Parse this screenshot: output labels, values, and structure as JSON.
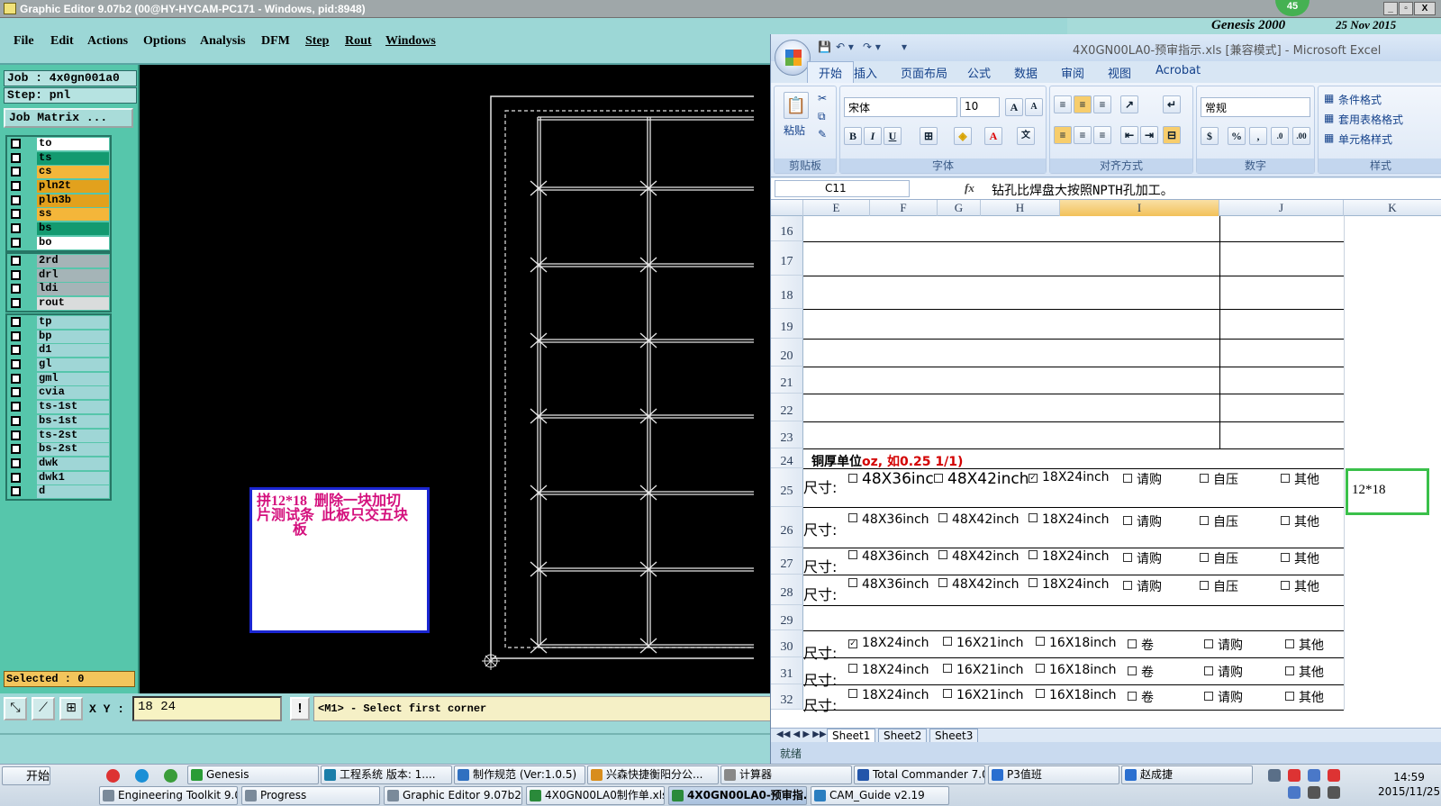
{
  "genesis": {
    "title": "Graphic Editor 9.07b2 (00@HY-HYCAM-PC171 - Windows, pid:8948)",
    "menu": [
      "File",
      "Edit",
      "Actions",
      "Options",
      "Analysis",
      "DFM",
      "Step",
      "Rout",
      "Windows"
    ],
    "logo": "Genesis 2000",
    "logo_date": "25 Nov 2015",
    "job": "Job : 4x0gn001a0",
    "step": "Step: pnl",
    "job_matrix": "Job Matrix ...",
    "selected": "Selected : 0",
    "layer_groups": [
      [
        {
          "name": "to",
          "color": "#ffffff"
        },
        {
          "name": "ts",
          "color": "#139a70"
        },
        {
          "name": "cs",
          "color": "#f4b63a"
        },
        {
          "name": "pln2t",
          "color": "#e2a11d"
        },
        {
          "name": "pln3b",
          "color": "#e2a11d"
        },
        {
          "name": "ss",
          "color": "#f4b63a"
        },
        {
          "name": "bs",
          "color": "#139a70"
        },
        {
          "name": "bo",
          "color": "#ffffff"
        }
      ],
      [
        {
          "name": "2rd",
          "color": "#a5b4b7"
        },
        {
          "name": "drl",
          "color": "#a5b4b7"
        },
        {
          "name": "ldi",
          "color": "#a5b4b7"
        },
        {
          "name": "rout",
          "color": "#d9dcdc"
        }
      ],
      [
        {
          "name": "tp",
          "color": "#9fd6d6"
        },
        {
          "name": "bp",
          "color": "#9fd6d6"
        },
        {
          "name": "d1",
          "color": "#9fd6d6"
        },
        {
          "name": "gl",
          "color": "#9fd6d6"
        },
        {
          "name": "gml",
          "color": "#9fd6d6"
        },
        {
          "name": "cvia",
          "color": "#9fd6d6"
        },
        {
          "name": "ts-1st",
          "color": "#9fd6d6"
        },
        {
          "name": "bs-1st",
          "color": "#9fd6d6"
        },
        {
          "name": "ts-2st",
          "color": "#9fd6d6"
        },
        {
          "name": "bs-2st",
          "color": "#9fd6d6"
        },
        {
          "name": "dwk",
          "color": "#9fd6d6"
        },
        {
          "name": "dwk1",
          "color": "#9fd6d6"
        },
        {
          "name": "d",
          "color": "#9fd6d6"
        }
      ]
    ],
    "note": "拼12*18  删除一块加切\n片测试条  此板只交五块\n          板",
    "xy_label": "X Y :",
    "xy_value": "18 24",
    "warn": "!",
    "prompt": "<M1> - Select first corner",
    "badge": "45"
  },
  "excel": {
    "title": "4X0GN00LA0-预审指示.xls  [兼容模式] - Microsoft Excel",
    "tabs": [
      "开始",
      "插入",
      "页面布局",
      "公式",
      "数据",
      "审阅",
      "视图",
      "Acrobat"
    ],
    "groups": {
      "clipboard": "剪贴板",
      "font": "字体",
      "align": "对齐方式",
      "number": "数字",
      "styles": "样式"
    },
    "paste": "粘贴",
    "font_name": "宋体",
    "font_size": "10",
    "number_format": "常规",
    "styles": [
      "条件格式",
      "套用表格格式",
      "单元格样式"
    ],
    "name_box": "C11",
    "formula": "钻孔比焊盘大按照NPTH孔加工。",
    "columns": [
      "E",
      "F",
      "G",
      "H",
      "I",
      "J",
      "K"
    ],
    "row_numbers": [
      "16",
      "17",
      "18",
      "19",
      "20",
      "21",
      "22",
      "23",
      "24",
      "25",
      "26",
      "27",
      "28",
      "29",
      "30",
      "31",
      "32"
    ],
    "row24_text": "铜厚单位",
    "row24_red": "oz, 如0.25 1/1)",
    "rows": [
      {
        "lead": "尺寸:",
        "items": [
          {
            "text": "48X36inc",
            "checked": false
          },
          {
            "text": "48X42inch",
            "checked": false
          },
          {
            "text": "18X24inch",
            "checked": true
          },
          {
            "text": "请购",
            "checked": false
          },
          {
            "text": "自压",
            "checked": false
          },
          {
            "text": "其他",
            "checked": false
          }
        ]
      },
      {
        "lead": "尺寸:",
        "items": [
          {
            "text": "48X36inch",
            "checked": false
          },
          {
            "text": "48X42inch",
            "checked": false
          },
          {
            "text": "18X24inch",
            "checked": false
          },
          {
            "text": "请购",
            "checked": false
          },
          {
            "text": "自压",
            "checked": false
          },
          {
            "text": "其他",
            "checked": false
          }
        ]
      },
      {
        "lead": "尺寸:",
        "items": [
          {
            "text": "48X36inch",
            "checked": false
          },
          {
            "text": "48X42inch",
            "checked": false
          },
          {
            "text": "18X24inch",
            "checked": false
          },
          {
            "text": "请购",
            "checked": false
          },
          {
            "text": "自压",
            "checked": false
          },
          {
            "text": "其他",
            "checked": false
          }
        ]
      },
      {
        "lead": "尺寸:",
        "items": [
          {
            "text": "48X36inch",
            "checked": false
          },
          {
            "text": "48X42inch",
            "checked": false
          },
          {
            "text": "18X24inch",
            "checked": false
          },
          {
            "text": "请购",
            "checked": false
          },
          {
            "text": "自压",
            "checked": false
          },
          {
            "text": "其他",
            "checked": false
          }
        ]
      },
      {
        "lead": "尺寸:",
        "items": [
          {
            "text": "18X24inch",
            "checked": true
          },
          {
            "text": "16X21inch",
            "checked": false
          },
          {
            "text": "16X18inch",
            "checked": false
          },
          {
            "text": "卷",
            "checked": false
          },
          {
            "text": "请购",
            "checked": false
          },
          {
            "text": "其他",
            "checked": false
          }
        ]
      },
      {
        "lead": "尺寸:",
        "items": [
          {
            "text": "18X24inch",
            "checked": false
          },
          {
            "text": "16X21inch",
            "checked": false
          },
          {
            "text": "16X18inch",
            "checked": false
          },
          {
            "text": "卷",
            "checked": false
          },
          {
            "text": "请购",
            "checked": false
          },
          {
            "text": "其他",
            "checked": false
          }
        ]
      },
      {
        "lead": "尺寸:",
        "items": [
          {
            "text": "18X24inch",
            "checked": false
          },
          {
            "text": "16X21inch",
            "checked": false
          },
          {
            "text": "16X18inch",
            "checked": false
          },
          {
            "text": "卷",
            "checked": false
          },
          {
            "text": "请购",
            "checked": false
          },
          {
            "text": "其他",
            "checked": false
          }
        ]
      }
    ],
    "selected_cell_value": "12*18",
    "sheets": [
      "Sheet1",
      "Sheet2",
      "Sheet3"
    ],
    "status": "就绪"
  },
  "taskbar": {
    "start": "开始",
    "row1": [
      "Genesis",
      "工程系统  版本: 1....",
      "制作规范 (Ver:1.0.5)",
      "兴森快捷衡阳分公...",
      "计算器",
      "Total Commander 7.0...",
      "P3值班",
      "赵成捷"
    ],
    "row2": [
      "Engineering Toolkit 9.07...",
      "Progress",
      "Graphic Editor 9.07b2 (0...",
      "4X0GN00LA0制作单.xls ...",
      "4X0GN00LA0-预审指...",
      "CAM_Guide v2.19"
    ],
    "time": "14:59",
    "date": "2015/11/25"
  }
}
